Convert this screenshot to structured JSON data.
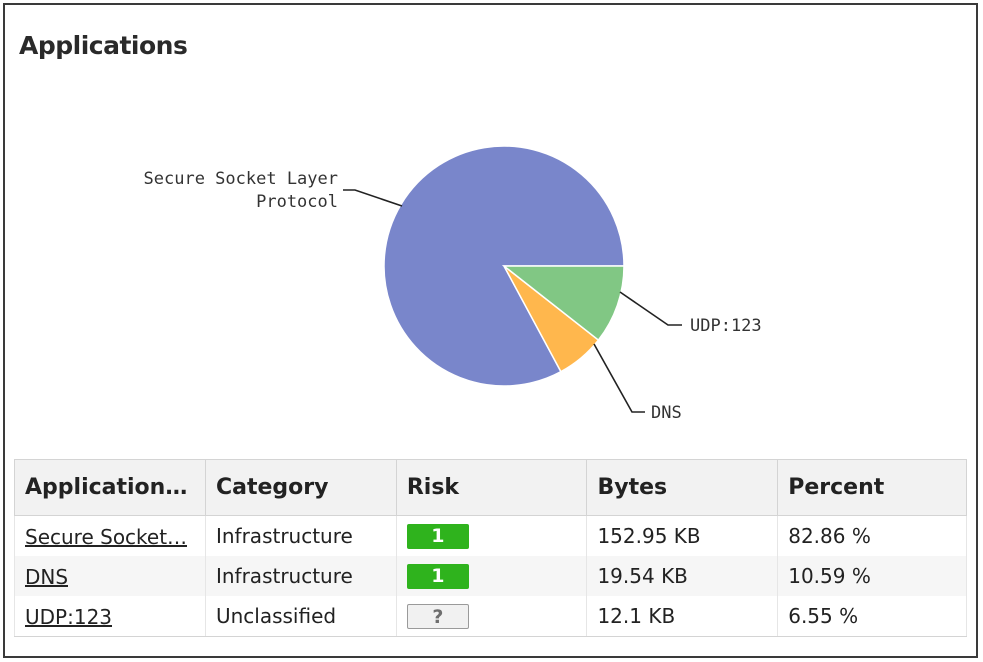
{
  "panel": {
    "title": "Applications"
  },
  "chart_data": {
    "type": "pie",
    "slices": [
      {
        "label": "Secure Socket Layer Protocol",
        "value": 82.86,
        "color": "#7986cb"
      },
      {
        "label": "UDP:123",
        "value": 6.55,
        "color": "#ffb74d"
      },
      {
        "label": "DNS",
        "value": 10.59,
        "color": "#81c784"
      }
    ],
    "labels_display": {
      "ssl_line1": "Secure Socket Layer",
      "ssl_line2": "Protocol",
      "udp": "UDP:123",
      "dns": "DNS"
    }
  },
  "table": {
    "headers": {
      "application": "Application…",
      "category": "Category",
      "risk": "Risk",
      "bytes": "Bytes",
      "percent": "Percent"
    },
    "rows": [
      {
        "application": "Secure Socket…",
        "category": "Infrastructure",
        "risk": "1",
        "bytes": "152.95 KB",
        "percent": "82.86 %"
      },
      {
        "application": "DNS",
        "category": "Infrastructure",
        "risk": "1",
        "bytes": "19.54 KB",
        "percent": "10.59 %"
      },
      {
        "application": "UDP:123",
        "category": "Unclassified",
        "risk": "?",
        "bytes": "12.1 KB",
        "percent": "6.55 %"
      }
    ]
  },
  "colors": {
    "risk_low": "#2fb31d",
    "risk_unknown_bg": "#f1f1f1"
  }
}
